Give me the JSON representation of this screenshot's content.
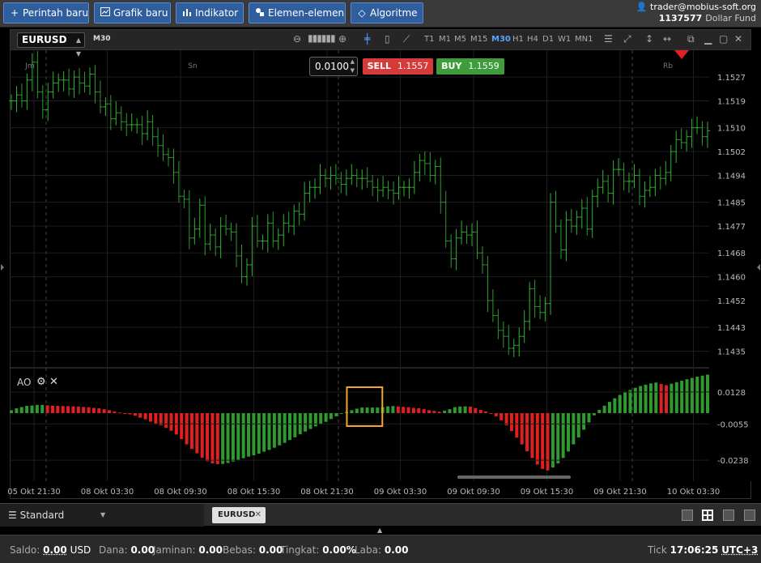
{
  "toolbar": {
    "buttons": [
      {
        "label": "Perintah baru",
        "icon": "plus-icon"
      },
      {
        "label": "Grafik baru",
        "icon": "chart-icon"
      },
      {
        "label": "Indikator",
        "icon": "bars-icon"
      },
      {
        "label": "Elemen-elemen",
        "icon": "shapes-icon"
      },
      {
        "label": "Algoritme",
        "icon": "diamond-icon"
      }
    ]
  },
  "account": {
    "user": "trader@mobius-soft.org",
    "number": "1137577",
    "fund": "Dollar Fund"
  },
  "chart": {
    "symbol": "EURUSD",
    "timeframe_badge": "M30",
    "timeframes": [
      "T1",
      "M1",
      "M5",
      "M15",
      "M30",
      "H1",
      "H4",
      "D1",
      "W1",
      "MN1"
    ],
    "active_timeframe": "M30",
    "lot": "0.0100",
    "sell_label": "SELL",
    "sell_price": "1.1557",
    "buy_label": "BUY",
    "buy_price": "1.1559",
    "day_labels": [
      "Jm",
      "Sn",
      "Rb"
    ],
    "indicator_label": "AO",
    "colors": {
      "up": "#2f9a2f",
      "down": "#e02020",
      "highlight": "#f5a623",
      "sell": "#d63b3b",
      "buy": "#3e9c3a"
    }
  },
  "chart_data": [
    {
      "type": "ohlc",
      "y_tick_labels": [
        "1.1527",
        "1.1519",
        "1.1510",
        "1.1502",
        "1.1494",
        "1.1485",
        "1.1477",
        "1.1468",
        "1.1460",
        "1.1452",
        "1.1443",
        "1.1435"
      ],
      "x_tick_labels": [
        "05 Okt 21:30",
        "08 Okt 03:30",
        "08 Okt 09:30",
        "08 Okt 15:30",
        "08 Okt 21:30",
        "09 Okt 03:30",
        "09 Okt 09:30",
        "09 Okt 15:30",
        "09 Okt 21:30",
        "10 Okt 03:30"
      ],
      "close": [
        1.1519,
        1.1521,
        1.1519,
        1.1526,
        1.1532,
        1.1522,
        1.1516,
        1.1522,
        1.1525,
        1.1526,
        1.1526,
        1.1523,
        1.1527,
        1.1525,
        1.1524,
        1.1528,
        1.1522,
        1.1517,
        1.1518,
        1.1513,
        1.1515,
        1.1512,
        1.1511,
        1.1511,
        1.1511,
        1.1508,
        1.1512,
        1.1507,
        1.1504,
        1.1501,
        1.15,
        1.1495,
        1.1487,
        1.1486,
        1.1473,
        1.1476,
        1.1484,
        1.1471,
        1.1474,
        1.147,
        1.1477,
        1.1476,
        1.1475,
        1.1467,
        1.146,
        1.1464,
        1.1477,
        1.1472,
        1.1472,
        1.1478,
        1.1472,
        1.1474,
        1.1478,
        1.1477,
        1.1482,
        1.1481,
        1.1488,
        1.149,
        1.149,
        1.1494,
        1.1493,
        1.1494,
        1.1493,
        1.1491,
        1.1493,
        1.1494,
        1.1493,
        1.1493,
        1.1492,
        1.149,
        1.1489,
        1.149,
        1.1489,
        1.1488,
        1.149,
        1.149,
        1.149,
        1.1495,
        1.1499,
        1.1498,
        1.1494,
        1.1497,
        1.1485,
        1.1472,
        1.1466,
        1.1473,
        1.1475,
        1.1474,
        1.1475,
        1.1468,
        1.1464,
        1.1452,
        1.1447,
        1.1442,
        1.144,
        1.1436,
        1.1437,
        1.144,
        1.1445,
        1.1456,
        1.145,
        1.1448,
        1.1451,
        1.1485,
        1.1477,
        1.1469,
        1.1479,
        1.1477,
        1.148,
        1.1483,
        1.1476,
        1.1487,
        1.149,
        1.1492,
        1.1488,
        1.1496,
        1.1496,
        1.1492,
        1.1492,
        1.1494,
        1.1487,
        1.1489,
        1.149,
        1.1494,
        1.1493,
        1.1495,
        1.1502,
        1.1506,
        1.1505,
        1.1507,
        1.151,
        1.151,
        1.1507,
        1.1509
      ],
      "ylim": [
        1.143,
        1.1536
      ]
    },
    {
      "type": "bar",
      "title": "AO",
      "y_tick_labels": [
        "0.0128",
        "-0.0055",
        "-0.0238"
      ],
      "values": [
        0.0017,
        0.0029,
        0.0037,
        0.0044,
        0.0046,
        0.005,
        0.005,
        0.0047,
        0.0045,
        0.0044,
        0.0043,
        0.0042,
        0.0041,
        0.004,
        0.0037,
        0.0035,
        0.0032,
        0.0029,
        0.0024,
        0.0018,
        0.001,
        0.0004,
        0.0,
        -0.0006,
        -0.0013,
        -0.0023,
        -0.0031,
        -0.0043,
        -0.0053,
        -0.0061,
        -0.0075,
        -0.0089,
        -0.0108,
        -0.0131,
        -0.0158,
        -0.0181,
        -0.0203,
        -0.0226,
        -0.0243,
        -0.0254,
        -0.0258,
        -0.0257,
        -0.0252,
        -0.0245,
        -0.0236,
        -0.0228,
        -0.022,
        -0.0213,
        -0.0205,
        -0.0195,
        -0.0186,
        -0.0175,
        -0.0163,
        -0.015,
        -0.0136,
        -0.0122,
        -0.0107,
        -0.0093,
        -0.008,
        -0.0067,
        -0.0055,
        -0.0044,
        -0.003,
        -0.0016,
        -0.0004,
        0.0007,
        0.0018,
        0.0027,
        0.0034,
        0.0034,
        0.0034,
        0.0034,
        0.0036,
        0.0041,
        0.0043,
        0.004,
        0.0038,
        0.0036,
        0.0032,
        0.003,
        0.0024,
        0.0018,
        0.0014,
        0.0009,
        0.0015,
        0.0024,
        0.0036,
        0.004,
        0.0041,
        0.004,
        0.003,
        0.002,
        0.001,
        0.0,
        -0.0016,
        -0.0036,
        -0.0062,
        -0.0091,
        -0.0124,
        -0.0158,
        -0.0193,
        -0.0227,
        -0.026,
        -0.0282,
        -0.029,
        -0.0275,
        -0.0254,
        -0.0227,
        -0.0194,
        -0.0158,
        -0.0123,
        -0.0084,
        -0.0047,
        -0.0011,
        0.002,
        0.0045,
        0.0068,
        0.009,
        0.011,
        0.0126,
        0.014,
        0.0153,
        0.0164,
        0.0172,
        0.018,
        0.0185,
        0.0176,
        0.0169,
        0.0178,
        0.0187,
        0.0196,
        0.0205,
        0.0213,
        0.0221,
        0.0227,
        0.0233
      ],
      "highlight_range": [
        66,
        71
      ]
    }
  ],
  "tabs": {
    "workspace": "Standard",
    "symbol_tab": "EURUSD"
  },
  "status": {
    "saldo_label": "Saldo:",
    "saldo": "0.00",
    "currency": "USD",
    "dana_label": "Dana:",
    "dana": "0.00",
    "jaminan_label": "Jaminan:",
    "jaminan": "0.00",
    "bebas_label": "Bebas:",
    "bebas": "0.00",
    "tingkat_label": "Tingkat:",
    "tingkat": "0.00%",
    "laba_label": "Laba:",
    "laba": "0.00",
    "tick_label": "Tick",
    "time": "17:06:25",
    "timezone": "UTC+3"
  }
}
